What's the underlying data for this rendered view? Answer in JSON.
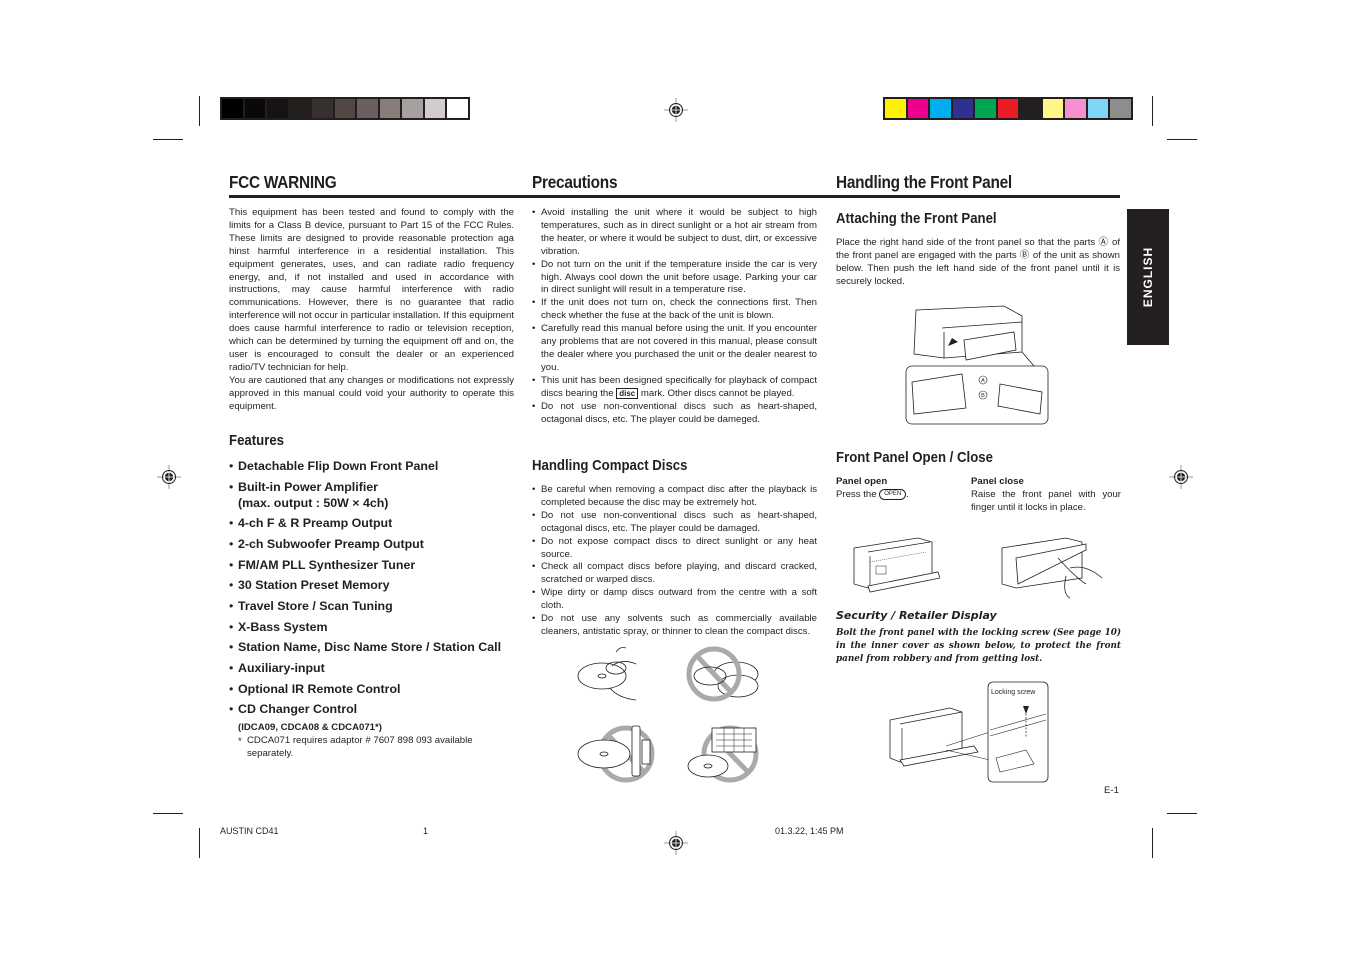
{
  "colors": {
    "ink": "#231f20",
    "grayscale_bar": [
      "#000000",
      "#0a0908",
      "#161312",
      "#231f1d",
      "#38302e",
      "#514745",
      "#6a605e",
      "#877d7b",
      "#a8a09e",
      "#d2cccc",
      "#ffffff"
    ],
    "color_bar": [
      "#fff200",
      "#ec008c",
      "#00aeef",
      "#2e3192",
      "#00a651",
      "#ed1c24",
      "#231f20",
      "#fff685",
      "#f68fcf",
      "#7fd6f7",
      "#8d8d8d"
    ]
  },
  "sections": {
    "fcc": {
      "title": "FCC WARNING",
      "paragraph1": "This equipment has been tested and found to comply with the limits for a Class B device, pursuant to Part 15 of the FCC Rules. These limits are designed to provide reasonable protection aga hinst harmful interference in a residential installation. This equipment generates, uses, and can radiate radio frequency energy, and, if not installed and used in accordance with instructions, may cause harmful interference with radio communications. However, there is no guarantee that radio interference will not occur in particular installation. If this equipment does cause harmful interference to radio or television reception, which can be determined by turning the equipment off and on, the user is encouraged to consult the dealer or an experienced radio/TV technician for help.",
      "paragraph2": "You are cautioned that any changes or modifications not expressly approved in this manual could void your authority to operate this equipment."
    },
    "features": {
      "title": "Features",
      "items": [
        "Detachable Flip Down Front Panel",
        "Built-in Power Amplifier",
        "4-ch F & R Preamp Output",
        "2-ch Subwoofer Preamp Output",
        "FM/AM PLL Synthesizer Tuner",
        "30 Station Preset Memory",
        "Travel Store / Scan Tuning",
        "X-Bass System",
        "Station Name, Disc Name Store / Station Call",
        "Auxiliary-input",
        "Optional IR Remote Control",
        "CD Changer Control"
      ],
      "amp_detail": "(max. output : 50W × 4ch)",
      "changer_models": "(IDCA09, CDCA08 & CDCA071*)",
      "footnote": "CDCA071 requires adaptor # 7607 898 093 available separately.",
      "footnote_mark": "*"
    },
    "precautions": {
      "title": "Precautions",
      "items": [
        "Avoid installing the unit where it would be subject to high temperatures, such as in direct sunlight or a hot air stream from the heater, or where it would be subject to dust, dirt, or excessive vibration.",
        "Do not turn on the unit if the temperature inside the car is very high. Always cool down the unit before usage. Parking your car in direct sunlight will result in a temperature rise.",
        "If the unit does not turn on, check the connections first. Then check whether the fuse at the back of the unit is blown.",
        "Carefully read this manual before using the unit. If you encounter any problems that are not covered in this manual, please consult the dealer where you purchased the unit or the dealer nearest to you."
      ],
      "disc_item_before": "This unit has been designed specifically for playback of compact discs bearing the",
      "disc_item_after": "mark. Other discs cannot be played.",
      "disc_logo_text": "disc",
      "last_item": "Do not use non-conventional discs such as heart-shaped, octagonal discs, etc. The player could be dameged."
    },
    "handling_discs": {
      "title": "Handling Compact Discs",
      "items": [
        "Be careful when removing a compact disc after the playback is completed because the disc may be extremely hot.",
        "Do not use non-conventional discs such as heart-shaped, octagonal discs, etc. The player could be damaged.",
        "Do not expose compact discs to direct sunlight or any heat source.",
        "Check all compact discs before playing, and discard cracked, scratched or warped discs.",
        "Wipe dirty or damp discs outward from the centre with a soft cloth.",
        "Do not use any solvents such as commercially available cleaners, antistatic spray, or thinner to clean the compact discs."
      ]
    },
    "front_panel": {
      "title": "Handling the Front Panel",
      "attaching": {
        "title": "Attaching the Front Panel",
        "text": "Place the right hand side of the front panel so that the parts Ⓐ of the front panel are engaged with the parts Ⓑ of the unit as shown below. Then push the left hand side of the front panel until it is securely locked.",
        "label_a": "A",
        "label_b": "B"
      },
      "open_close": {
        "title": "Front Panel Open / Close",
        "open_title": "Panel open",
        "open_text_before": "Press the",
        "open_button": "OPEN",
        "open_text_after": ".",
        "close_title": "Panel close",
        "close_text": "Raise the front panel with your finger until it locks in place."
      },
      "security": {
        "title": "Security / Retailer Display",
        "text": "Bolt the front panel with the locking screw (See page 10) in the inner cover as shown below, to protect the front panel from robbery and from getting lost.",
        "callout": "Locking screw"
      }
    }
  },
  "side_tab": "ENGLISH",
  "page_number": "E-1",
  "footer": {
    "model": "AUSTIN CD41",
    "page": "1",
    "timestamp": "01.3.22, 1:45 PM"
  }
}
